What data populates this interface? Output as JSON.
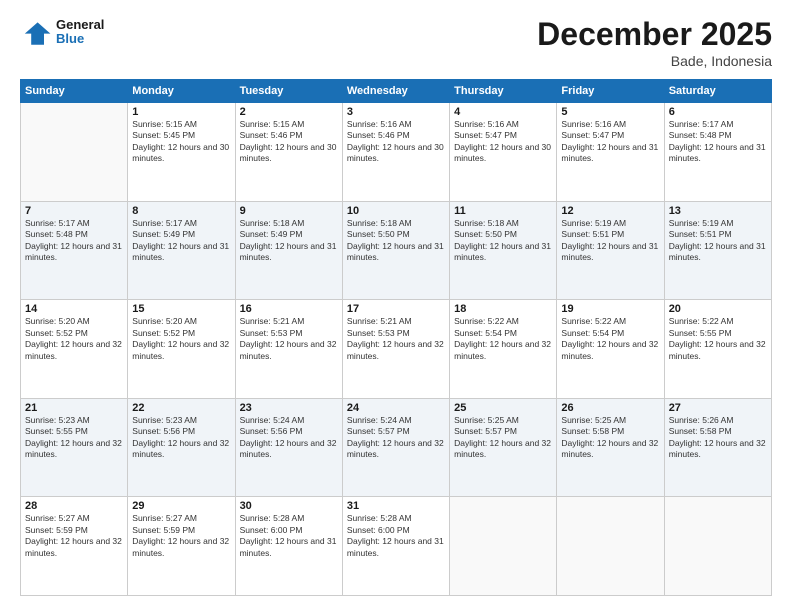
{
  "logo": {
    "line1": "General",
    "line2": "Blue"
  },
  "header": {
    "month": "December 2025",
    "location": "Bade, Indonesia"
  },
  "weekdays": [
    "Sunday",
    "Monday",
    "Tuesday",
    "Wednesday",
    "Thursday",
    "Friday",
    "Saturday"
  ],
  "weeks": [
    [
      {
        "day": null
      },
      {
        "day": 1,
        "sunrise": "5:15 AM",
        "sunset": "5:45 PM",
        "daylight": "12 hours and 30 minutes."
      },
      {
        "day": 2,
        "sunrise": "5:15 AM",
        "sunset": "5:46 PM",
        "daylight": "12 hours and 30 minutes."
      },
      {
        "day": 3,
        "sunrise": "5:16 AM",
        "sunset": "5:46 PM",
        "daylight": "12 hours and 30 minutes."
      },
      {
        "day": 4,
        "sunrise": "5:16 AM",
        "sunset": "5:47 PM",
        "daylight": "12 hours and 30 minutes."
      },
      {
        "day": 5,
        "sunrise": "5:16 AM",
        "sunset": "5:47 PM",
        "daylight": "12 hours and 31 minutes."
      },
      {
        "day": 6,
        "sunrise": "5:17 AM",
        "sunset": "5:48 PM",
        "daylight": "12 hours and 31 minutes."
      }
    ],
    [
      {
        "day": 7,
        "sunrise": "5:17 AM",
        "sunset": "5:48 PM",
        "daylight": "12 hours and 31 minutes."
      },
      {
        "day": 8,
        "sunrise": "5:17 AM",
        "sunset": "5:49 PM",
        "daylight": "12 hours and 31 minutes."
      },
      {
        "day": 9,
        "sunrise": "5:18 AM",
        "sunset": "5:49 PM",
        "daylight": "12 hours and 31 minutes."
      },
      {
        "day": 10,
        "sunrise": "5:18 AM",
        "sunset": "5:50 PM",
        "daylight": "12 hours and 31 minutes."
      },
      {
        "day": 11,
        "sunrise": "5:18 AM",
        "sunset": "5:50 PM",
        "daylight": "12 hours and 31 minutes."
      },
      {
        "day": 12,
        "sunrise": "5:19 AM",
        "sunset": "5:51 PM",
        "daylight": "12 hours and 31 minutes."
      },
      {
        "day": 13,
        "sunrise": "5:19 AM",
        "sunset": "5:51 PM",
        "daylight": "12 hours and 31 minutes."
      }
    ],
    [
      {
        "day": 14,
        "sunrise": "5:20 AM",
        "sunset": "5:52 PM",
        "daylight": "12 hours and 32 minutes."
      },
      {
        "day": 15,
        "sunrise": "5:20 AM",
        "sunset": "5:52 PM",
        "daylight": "12 hours and 32 minutes."
      },
      {
        "day": 16,
        "sunrise": "5:21 AM",
        "sunset": "5:53 PM",
        "daylight": "12 hours and 32 minutes."
      },
      {
        "day": 17,
        "sunrise": "5:21 AM",
        "sunset": "5:53 PM",
        "daylight": "12 hours and 32 minutes."
      },
      {
        "day": 18,
        "sunrise": "5:22 AM",
        "sunset": "5:54 PM",
        "daylight": "12 hours and 32 minutes."
      },
      {
        "day": 19,
        "sunrise": "5:22 AM",
        "sunset": "5:54 PM",
        "daylight": "12 hours and 32 minutes."
      },
      {
        "day": 20,
        "sunrise": "5:22 AM",
        "sunset": "5:55 PM",
        "daylight": "12 hours and 32 minutes."
      }
    ],
    [
      {
        "day": 21,
        "sunrise": "5:23 AM",
        "sunset": "5:55 PM",
        "daylight": "12 hours and 32 minutes."
      },
      {
        "day": 22,
        "sunrise": "5:23 AM",
        "sunset": "5:56 PM",
        "daylight": "12 hours and 32 minutes."
      },
      {
        "day": 23,
        "sunrise": "5:24 AM",
        "sunset": "5:56 PM",
        "daylight": "12 hours and 32 minutes."
      },
      {
        "day": 24,
        "sunrise": "5:24 AM",
        "sunset": "5:57 PM",
        "daylight": "12 hours and 32 minutes."
      },
      {
        "day": 25,
        "sunrise": "5:25 AM",
        "sunset": "5:57 PM",
        "daylight": "12 hours and 32 minutes."
      },
      {
        "day": 26,
        "sunrise": "5:25 AM",
        "sunset": "5:58 PM",
        "daylight": "12 hours and 32 minutes."
      },
      {
        "day": 27,
        "sunrise": "5:26 AM",
        "sunset": "5:58 PM",
        "daylight": "12 hours and 32 minutes."
      }
    ],
    [
      {
        "day": 28,
        "sunrise": "5:27 AM",
        "sunset": "5:59 PM",
        "daylight": "12 hours and 32 minutes."
      },
      {
        "day": 29,
        "sunrise": "5:27 AM",
        "sunset": "5:59 PM",
        "daylight": "12 hours and 32 minutes."
      },
      {
        "day": 30,
        "sunrise": "5:28 AM",
        "sunset": "6:00 PM",
        "daylight": "12 hours and 31 minutes."
      },
      {
        "day": 31,
        "sunrise": "5:28 AM",
        "sunset": "6:00 PM",
        "daylight": "12 hours and 31 minutes."
      },
      {
        "day": null
      },
      {
        "day": null
      },
      {
        "day": null
      }
    ]
  ]
}
